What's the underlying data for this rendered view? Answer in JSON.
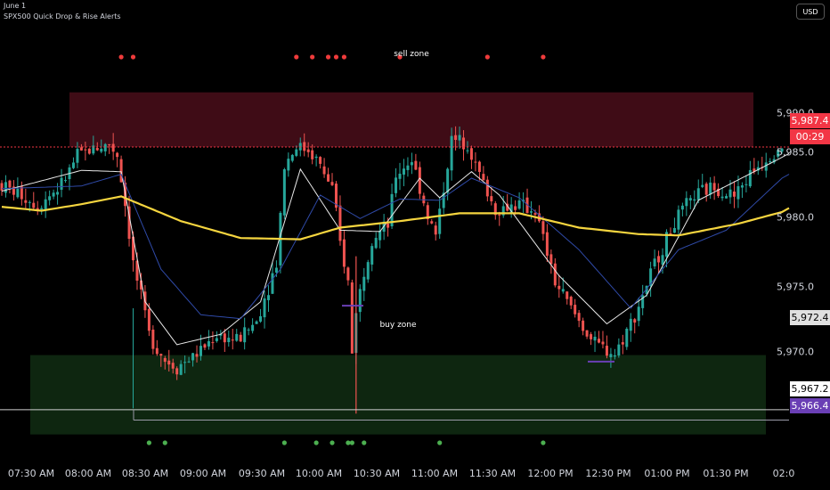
{
  "header": {
    "date": "June 1",
    "indicator": "SPX500 Quick Drop & Rise Alerts"
  },
  "currency_button": "USD",
  "zones": {
    "sell_label": "sell zone",
    "buy_label": "buy zone"
  },
  "colors": {
    "up": "#26a69a",
    "down": "#ef5350",
    "sell_zone": "#4a0e1a",
    "buy_zone": "#0f2a12",
    "ma_white": "#e8e8e8",
    "ma_blue": "#2f4aa8",
    "ma_yellow": "#f5d53f",
    "red_dot": "#ef3b3b",
    "green_dot": "#4caf50",
    "price_red": "#f23645",
    "level_purple": "#6a3fb5"
  },
  "y_axis": {
    "ticks": [
      "5,990.0",
      "5,985.0",
      "5,980.0",
      "5,975.0",
      "5,970.0"
    ]
  },
  "x_axis": {
    "ticks": [
      "07:30 AM",
      "08:00 AM",
      "08:30 AM",
      "09:00 AM",
      "09:30 AM",
      "10:00 AM",
      "10:30 AM",
      "11:00 AM",
      "11:30 AM",
      "12:00 PM",
      "12:30 PM",
      "01:00 PM",
      "01:30 PM",
      "02:0"
    ]
  },
  "price_tags": {
    "last": "5,987.4",
    "countdown": "00:29",
    "level_a": "5,972.4",
    "level_b": "5,967.2",
    "level_c": "5,966.4"
  },
  "chart_data": {
    "type": "candlestick",
    "x_start": "07:25 AM",
    "bar_minutes": 2,
    "bars": 197,
    "ylim": [
      5963.5,
      5994
    ],
    "sell_zone": [
      5987.4,
      5991.6
    ],
    "buy_zone": [
      5965.3,
      5971.4
    ],
    "horizontal_levels": [
      5987.4,
      5967.2,
      5966.4
    ],
    "price_path": [
      [
        0,
        5984.6
      ],
      [
        6,
        5983.7
      ],
      [
        10,
        5982.9
      ],
      [
        16,
        5984.5
      ],
      [
        20,
        5986.7
      ],
      [
        24,
        5987.3
      ],
      [
        28,
        5987.6
      ],
      [
        30,
        5986.8
      ],
      [
        32,
        5983.0
      ],
      [
        34,
        5978.5
      ],
      [
        38,
        5973.0
      ],
      [
        42,
        5971.0
      ],
      [
        45,
        5970.5
      ],
      [
        50,
        5971.5
      ],
      [
        55,
        5973.0
      ],
      [
        60,
        5972.5
      ],
      [
        65,
        5974.0
      ],
      [
        70,
        5978.5
      ],
      [
        72,
        5986.0
      ],
      [
        75,
        5987.5
      ],
      [
        78,
        5987.2
      ],
      [
        80,
        5986.5
      ],
      [
        84,
        5984.2
      ],
      [
        86,
        5980.0
      ],
      [
        88,
        5977.0
      ],
      [
        89,
        5971.5
      ],
      [
        90,
        5975.0
      ],
      [
        94,
        5980.5
      ],
      [
        98,
        5981.3
      ],
      [
        100,
        5985.2
      ],
      [
        104,
        5986.5
      ],
      [
        108,
        5982.1
      ],
      [
        110,
        5980.6
      ],
      [
        114,
        5987.9
      ],
      [
        118,
        5987.8
      ],
      [
        120,
        5986.0
      ],
      [
        125,
        5982.5
      ],
      [
        130,
        5983.0
      ],
      [
        135,
        5982.5
      ],
      [
        140,
        5977.0
      ],
      [
        145,
        5974.5
      ],
      [
        150,
        5972.2
      ],
      [
        155,
        5971.5
      ],
      [
        160,
        5974.5
      ],
      [
        165,
        5978.4
      ],
      [
        170,
        5981.6
      ],
      [
        175,
        5983.6
      ],
      [
        180,
        5984.4
      ],
      [
        185,
        5983.6
      ],
      [
        190,
        5985.7
      ],
      [
        196,
        5987.4
      ]
    ],
    "moving_averages": [
      {
        "color": "white",
        "path": [
          [
            0,
            5984.0
          ],
          [
            20,
            5985.6
          ],
          [
            30,
            5985.5
          ],
          [
            36,
            5975.5
          ],
          [
            44,
            5972.2
          ],
          [
            55,
            5973.0
          ],
          [
            65,
            5975.5
          ],
          [
            75,
            5985.7
          ],
          [
            85,
            5981.0
          ],
          [
            95,
            5980.9
          ],
          [
            105,
            5985.0
          ],
          [
            110,
            5983.5
          ],
          [
            118,
            5985.5
          ],
          [
            125,
            5983.7
          ],
          [
            140,
            5977.5
          ],
          [
            152,
            5973.8
          ],
          [
            162,
            5976.0
          ],
          [
            175,
            5983.3
          ],
          [
            196,
            5986.6
          ]
        ]
      },
      {
        "color": "blue",
        "path": [
          [
            0,
            5984.2
          ],
          [
            20,
            5984.4
          ],
          [
            30,
            5985.3
          ],
          [
            40,
            5978.0
          ],
          [
            50,
            5974.5
          ],
          [
            60,
            5974.2
          ],
          [
            70,
            5978.0
          ],
          [
            80,
            5983.7
          ],
          [
            90,
            5981.9
          ],
          [
            100,
            5983.4
          ],
          [
            110,
            5983.3
          ],
          [
            118,
            5985.0
          ],
          [
            130,
            5983.5
          ],
          [
            145,
            5979.5
          ],
          [
            158,
            5975.0
          ],
          [
            170,
            5979.5
          ],
          [
            182,
            5981.0
          ],
          [
            196,
            5985.0
          ]
        ]
      },
      {
        "color": "yellow",
        "path": [
          [
            0,
            5982.8
          ],
          [
            10,
            5982.5
          ],
          [
            20,
            5983.0
          ],
          [
            30,
            5983.6
          ],
          [
            45,
            5981.7
          ],
          [
            60,
            5980.4
          ],
          [
            75,
            5980.3
          ],
          [
            85,
            5981.2
          ],
          [
            100,
            5981.7
          ],
          [
            115,
            5982.3
          ],
          [
            130,
            5982.3
          ],
          [
            145,
            5981.2
          ],
          [
            160,
            5980.7
          ],
          [
            170,
            5980.6
          ],
          [
            185,
            5981.5
          ],
          [
            196,
            5982.4
          ]
        ]
      }
    ],
    "drop_alerts_x": [
      30,
      33,
      74,
      78,
      82,
      84,
      86,
      100,
      122,
      136
    ],
    "rise_alerts_x": [
      37,
      41,
      71,
      79,
      83,
      87,
      88,
      91,
      110,
      136
    ]
  }
}
